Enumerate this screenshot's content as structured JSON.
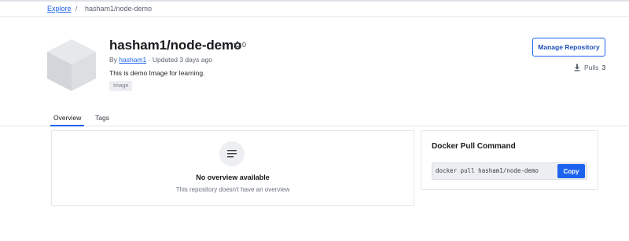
{
  "breadcrumb": {
    "root": "Explore",
    "separator": "/",
    "current": "hasham1/node-demo"
  },
  "repo": {
    "title": "hasham1/node-demo",
    "stars": "0",
    "by_prefix": "By",
    "owner": "hasham1",
    "updated": "· Updated 3 days ago",
    "description": "This is demo Image for learning.",
    "badge": "Image",
    "icon": "cube-icon"
  },
  "actions": {
    "manage_label": "Manage Repository",
    "pulls_label": "Pulls",
    "pulls_count": "3"
  },
  "tabs": [
    {
      "label": "Overview",
      "active": true
    },
    {
      "label": "Tags",
      "active": false
    }
  ],
  "overview": {
    "icon": "document-icon",
    "title": "No overview available",
    "subtitle": "This repository doesn't have an overview"
  },
  "pull_command": {
    "title": "Docker Pull Command",
    "command": "docker pull hasham1/node-demo",
    "copy_label": "Copy"
  },
  "colors": {
    "accent": "#1d63ed",
    "border": "#e3e6ea",
    "muted_text": "#5b636d"
  }
}
